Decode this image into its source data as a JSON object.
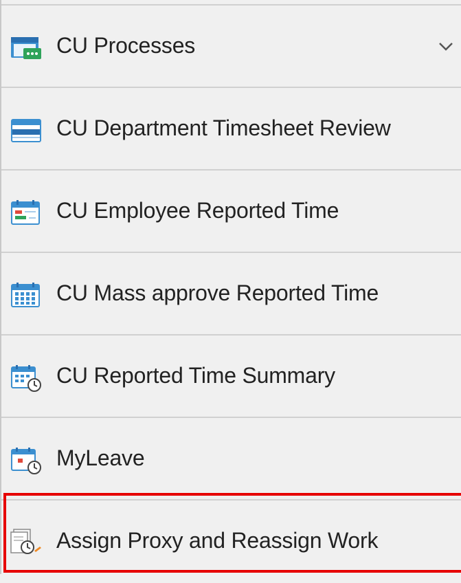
{
  "nav": {
    "items": [
      {
        "label": "CU Processes",
        "icon": "folder-process-icon",
        "expandable": true
      },
      {
        "label": "CU Department Timesheet Review",
        "icon": "timesheet-icon"
      },
      {
        "label": "CU Employee Reported Time",
        "icon": "calendar-entry-icon"
      },
      {
        "label": "CU Mass approve Reported Time",
        "icon": "calendar-grid-icon"
      },
      {
        "label": "CU Reported Time Summary",
        "icon": "calendar-clock-icon"
      },
      {
        "label": "MyLeave",
        "icon": "leave-calendar-icon"
      },
      {
        "label": "Assign Proxy and Reassign Work",
        "icon": "proxy-clock-icon"
      }
    ],
    "expand_icon": "chevron-down-icon",
    "highlighted_item": "Assign Proxy and Reassign Work",
    "highlight_color": "#e60000"
  }
}
